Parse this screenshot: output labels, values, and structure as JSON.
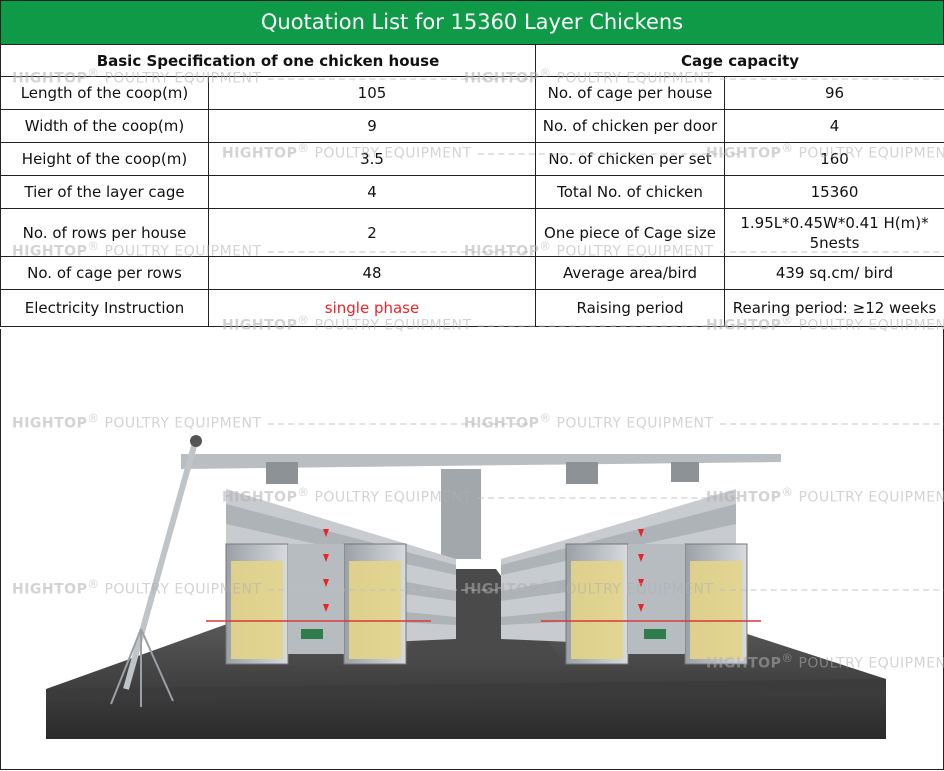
{
  "title": "Quotation List for 15360 Layer Chickens",
  "headers": {
    "left": "Basic Specification of one chicken house",
    "right": "Cage capacity"
  },
  "rows": [
    {
      "label": "Length of the coop(m)",
      "value": "105",
      "label2": "No. of cage per house",
      "value2": "96"
    },
    {
      "label": "Width of the coop(m)",
      "value": "9",
      "label2": "No. of chicken per door",
      "value2": "4"
    },
    {
      "label": "Height of the coop(m)",
      "value": "3.5",
      "label2": "No. of chicken per set",
      "value2": "160"
    },
    {
      "label": "Tier of the layer cage",
      "value": "4",
      "label2": "Total No. of chicken",
      "value2": "15360"
    },
    {
      "label": "No. of rows per house",
      "value": "2",
      "label2": "One piece of Cage size",
      "value2": "1.95L*0.45W*0.41 H(m)* 5nests"
    },
    {
      "label": "No. of cage per rows",
      "value": "48",
      "label2": "Average area/bird",
      "value2": "439 sq.cm/ bird"
    },
    {
      "label": "Electricity Instruction",
      "value": "single phase",
      "label2": "Raising period",
      "value2": "Rearing period: ≥12 weeks"
    }
  ],
  "watermark": {
    "brand": "HIGHTOP",
    "reg": "®",
    "tagline": " POULTRY EQUIPMENT"
  },
  "colors": {
    "title_bg": "#0f9a48",
    "highlight_text": "#e8242a",
    "cage_panel": "#e3d58a"
  }
}
